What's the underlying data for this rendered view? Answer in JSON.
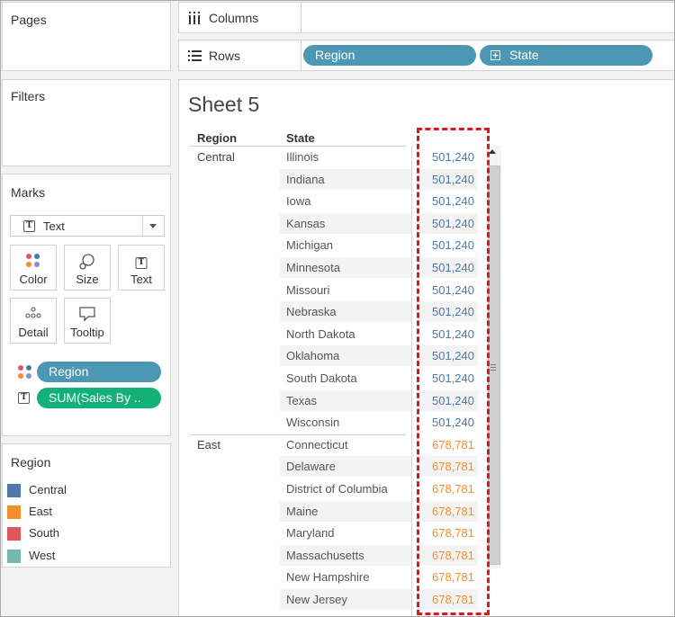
{
  "left_panels": {
    "pages_title": "Pages",
    "filters_title": "Filters",
    "marks": {
      "title": "Marks",
      "mark_type": "Text",
      "buttons": [
        {
          "label": "Color",
          "icon": "color-dots-icon"
        },
        {
          "label": "Size",
          "icon": "size-icon"
        },
        {
          "label": "Text",
          "icon": "text-icon"
        },
        {
          "label": "Detail",
          "icon": "detail-icon"
        },
        {
          "label": "Tooltip",
          "icon": "tooltip-icon"
        }
      ],
      "pills": [
        {
          "label": "Region",
          "icon": "color-dots-icon",
          "color": "#4b97b4"
        },
        {
          "label": "SUM(Sales By ..",
          "icon": "text-icon",
          "color": "#14b07a"
        }
      ]
    },
    "legend": {
      "title": "Region",
      "items": [
        {
          "label": "Central",
          "color": "#4e79a7"
        },
        {
          "label": "East",
          "color": "#f28e2b"
        },
        {
          "label": "South",
          "color": "#e15759"
        },
        {
          "label": "West",
          "color": "#76b7b2"
        }
      ]
    }
  },
  "shelves": {
    "columns_label": "Columns",
    "rows_label": "Rows",
    "rows_pills": [
      {
        "label": "Region",
        "color": "#4b97b4"
      },
      {
        "label": "State",
        "color": "#4b97b4",
        "icon": "plus-box-icon"
      }
    ]
  },
  "sheet": {
    "title": "Sheet 5",
    "headers": {
      "region": "Region",
      "state": "State"
    },
    "groups": [
      {
        "region": "Central",
        "value": "501,240",
        "color": "#4e79a7",
        "states": [
          "Illinois",
          "Indiana",
          "Iowa",
          "Kansas",
          "Michigan",
          "Minnesota",
          "Missouri",
          "Nebraska",
          "North Dakota",
          "Oklahoma",
          "South Dakota",
          "Texas",
          "Wisconsin"
        ]
      },
      {
        "region": "East",
        "value": "678,781",
        "color": "#f28e2b",
        "states": [
          "Connecticut",
          "Delaware",
          "District of Columbia",
          "Maine",
          "Maryland",
          "Massachusetts",
          "New Hampshire",
          "New Jersey"
        ]
      }
    ]
  },
  "colors": {
    "highlight": "#e2141d",
    "pill_blue": "#4b97b4",
    "pill_green": "#14b07a"
  }
}
